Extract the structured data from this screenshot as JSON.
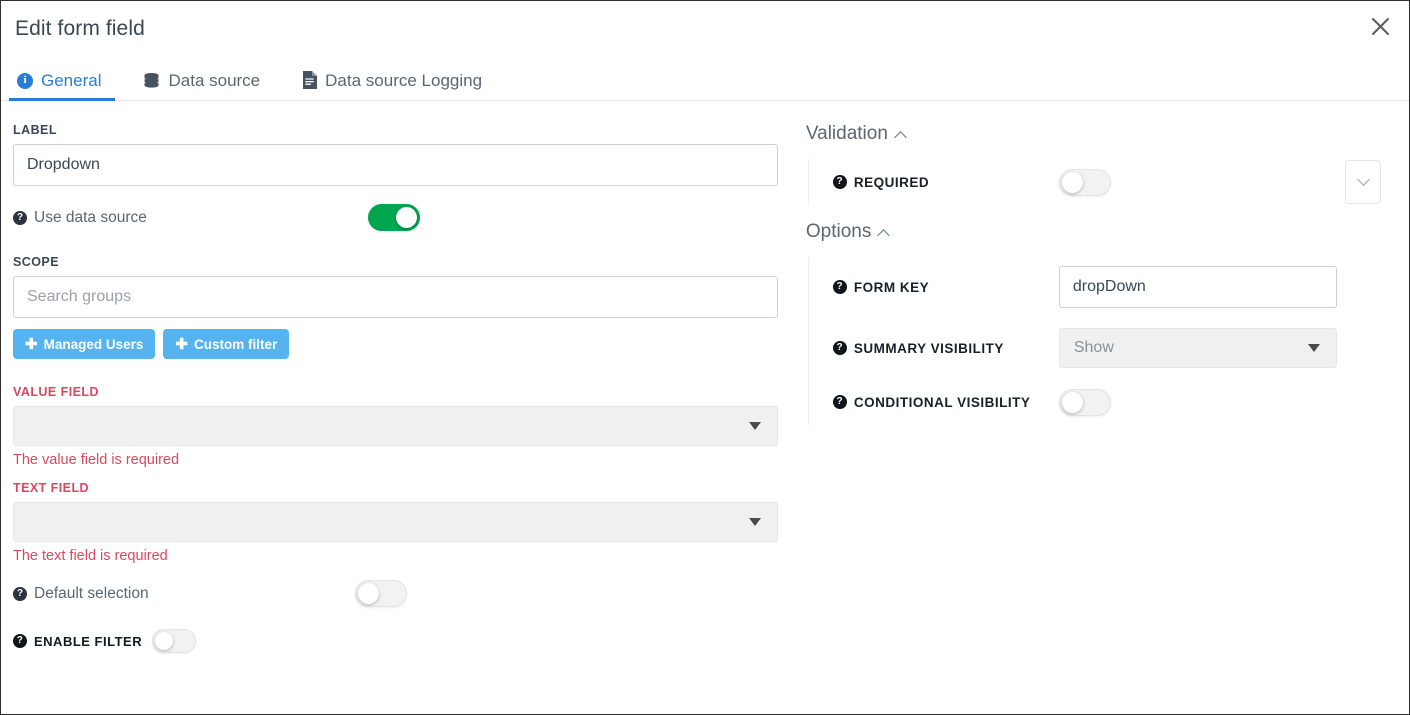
{
  "header": {
    "title": "Edit form field",
    "close_icon": "close-icon"
  },
  "tabs": [
    {
      "label": "General",
      "icon": "info-circle-icon",
      "active": true
    },
    {
      "label": "Data source",
      "icon": "database-icon",
      "active": false
    },
    {
      "label": "Data source Logging",
      "icon": "document-icon",
      "active": false
    }
  ],
  "left": {
    "label_heading": "LABEL",
    "label_value": "Dropdown",
    "use_data_source": {
      "label": "Use data source",
      "help_icon": "help-circle-icon",
      "state": "on"
    },
    "scope_heading": "SCOPE",
    "scope_placeholder": "Search groups",
    "scope_value": "",
    "buttons": [
      {
        "label": "Managed Users",
        "icon": "plus-icon"
      },
      {
        "label": "Custom filter",
        "icon": "plus-icon"
      }
    ],
    "value_field": {
      "heading": "VALUE FIELD",
      "value": "",
      "error": "The value field is required",
      "caret_icon": "caret-down-icon"
    },
    "text_field": {
      "heading": "TEXT FIELD",
      "value": "",
      "error": "The text field is required",
      "caret_icon": "caret-down-icon"
    },
    "default_selection": {
      "label": "Default selection",
      "help_icon": "help-circle-icon",
      "state": "off"
    },
    "enable_filter": {
      "label": "ENABLE FILTER",
      "help_icon": "help-circle-icon",
      "state": "off"
    }
  },
  "right": {
    "validation": {
      "heading": "Validation",
      "chevron_icon": "chevron-up-icon",
      "required": {
        "label": "REQUIRED",
        "help_icon": "help-circle-icon",
        "state": "off"
      },
      "collapse_icon": "chevron-down-icon"
    },
    "options": {
      "heading": "Options",
      "chevron_icon": "chevron-up-icon",
      "form_key": {
        "label": "FORM KEY",
        "help_icon": "help-circle-icon",
        "value": "dropDown"
      },
      "summary_visibility": {
        "label": "SUMMARY VISIBILITY",
        "help_icon": "help-circle-icon",
        "value": "Show",
        "caret_icon": "caret-down-icon"
      },
      "conditional_visibility": {
        "label": "CONDITIONAL VISIBILITY",
        "help_icon": "help-circle-icon",
        "state": "off"
      }
    }
  },
  "colors": {
    "accent_blue": "#2b7cd3",
    "button_blue": "#55b3ef",
    "toggle_on_green": "#00a550",
    "error_red": "#d9485f",
    "text_dark": "#3b4754"
  }
}
